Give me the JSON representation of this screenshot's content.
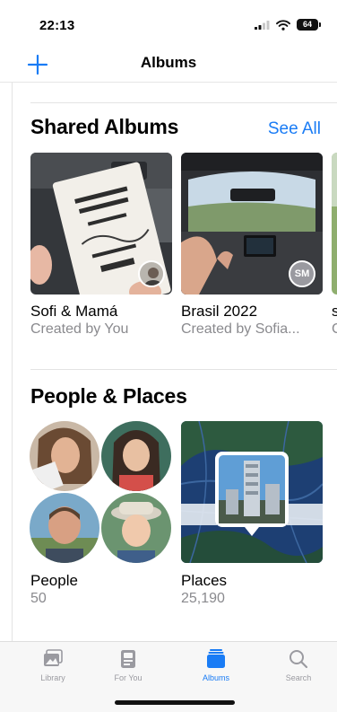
{
  "status_bar": {
    "time": "22:13",
    "battery": "64"
  },
  "nav": {
    "add_icon": "plus-icon",
    "title": "Albums"
  },
  "shared_albums": {
    "title": "Shared Albums",
    "see_all": "See All",
    "albums": [
      {
        "title": "Sofi & Mamá",
        "subtitle": "Created by You",
        "avatar": "photo"
      },
      {
        "title": "Brasil 2022",
        "subtitle": "Created by Sofia...",
        "avatar_initials": "SM"
      },
      {
        "title": "s",
        "subtitle": "C"
      }
    ]
  },
  "people_places": {
    "title": "People & Places",
    "people": {
      "title": "People",
      "count": "50"
    },
    "places": {
      "title": "Places",
      "count": "25,190"
    }
  },
  "tab_bar": {
    "tabs": [
      {
        "label": "Library",
        "icon": "photo-library-icon"
      },
      {
        "label": "For You",
        "icon": "for-you-icon"
      },
      {
        "label": "Albums",
        "icon": "albums-icon",
        "active": true
      },
      {
        "label": "Search",
        "icon": "search-icon"
      }
    ]
  },
  "colors": {
    "accent": "#1a7cf5",
    "secondary_text": "#8a8a8e"
  }
}
